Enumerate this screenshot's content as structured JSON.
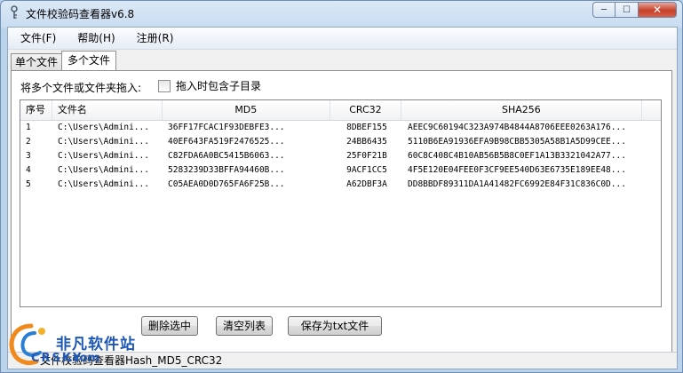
{
  "window": {
    "title": "文件校验码查看器v6.8",
    "min_glyph": "─",
    "max_glyph": "☐",
    "close_glyph": "✕"
  },
  "menu": [
    "文件(F)",
    "帮助(H)",
    "注册(R)"
  ],
  "tabs": [
    {
      "label": "单个文件",
      "active": false
    },
    {
      "label": "多个文件",
      "active": true
    }
  ],
  "panel": {
    "drop_label": "将多个文件或文件夹拖入:",
    "include_subdirs": {
      "label": "拖入时包含子目录",
      "checked": false
    }
  },
  "table": {
    "columns": [
      "序号",
      "文件名",
      "MD5",
      "CRC32",
      "SHA256"
    ],
    "rows": [
      {
        "no": "1",
        "name": "C:\\Users\\Admini...",
        "md5": "36FF17FCAC1F93DEBFE3...",
        "crc32": "8DBEF155",
        "sha256": "AEEC9C60194C323A974B4844A8706EEE0263A176..."
      },
      {
        "no": "2",
        "name": "C:\\Users\\Admini...",
        "md5": "40EF643FA519F2476525...",
        "crc32": "24BB6435",
        "sha256": "5110B6EA91936EFA9B98CBB5305A58B1A5D99CEE..."
      },
      {
        "no": "3",
        "name": "C:\\Users\\Admini...",
        "md5": "C82FDA6A0BC5415B6063...",
        "crc32": "25F0F21B",
        "sha256": "60C8C408C4B10AB56B5B8C0EF1A13B3321042A77..."
      },
      {
        "no": "4",
        "name": "C:\\Users\\Admini...",
        "md5": "5283239D33BFFA94460B...",
        "crc32": "9ACF1CC5",
        "sha256": "4F5E120E04FEE0F3CF9EE540D63E6735E189EE48..."
      },
      {
        "no": "5",
        "name": "C:\\Users\\Admini...",
        "md5": "C05AEA0D0D765FA6F25B...",
        "crc32": "A62DBF3A",
        "sha256": "DD8BBDF89311DA1A41482FC6992E84F31C836C0D..."
      }
    ]
  },
  "buttons": {
    "delete": "删除选中",
    "clear": "清空列表",
    "save": "保存为txt文件"
  },
  "status": "文件校验码查看器Hash_MD5_CRC32",
  "watermark": {
    "brand": "非凡软件站",
    "sub": "CRSKY",
    "sub2": ".com"
  }
}
